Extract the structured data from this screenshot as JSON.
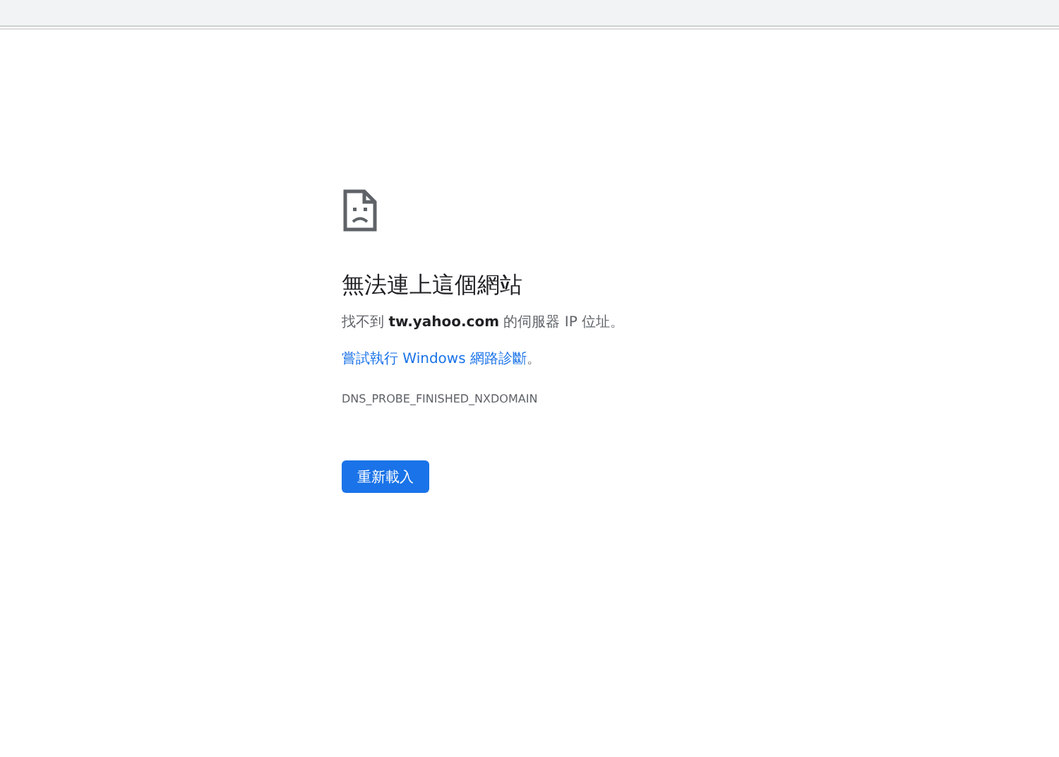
{
  "error": {
    "title": "無法連上這個網站",
    "message": "找不到 **tw.yahoo.com** 的伺服器 IP 位址。",
    "suggestion": {
      "link": "嘗試執行 Windows 網路診斷",
      "suffix": "。"
    },
    "code": "DNS_PROBE_FINISHED_NXDOMAIN",
    "button": "重新載入"
  }
}
